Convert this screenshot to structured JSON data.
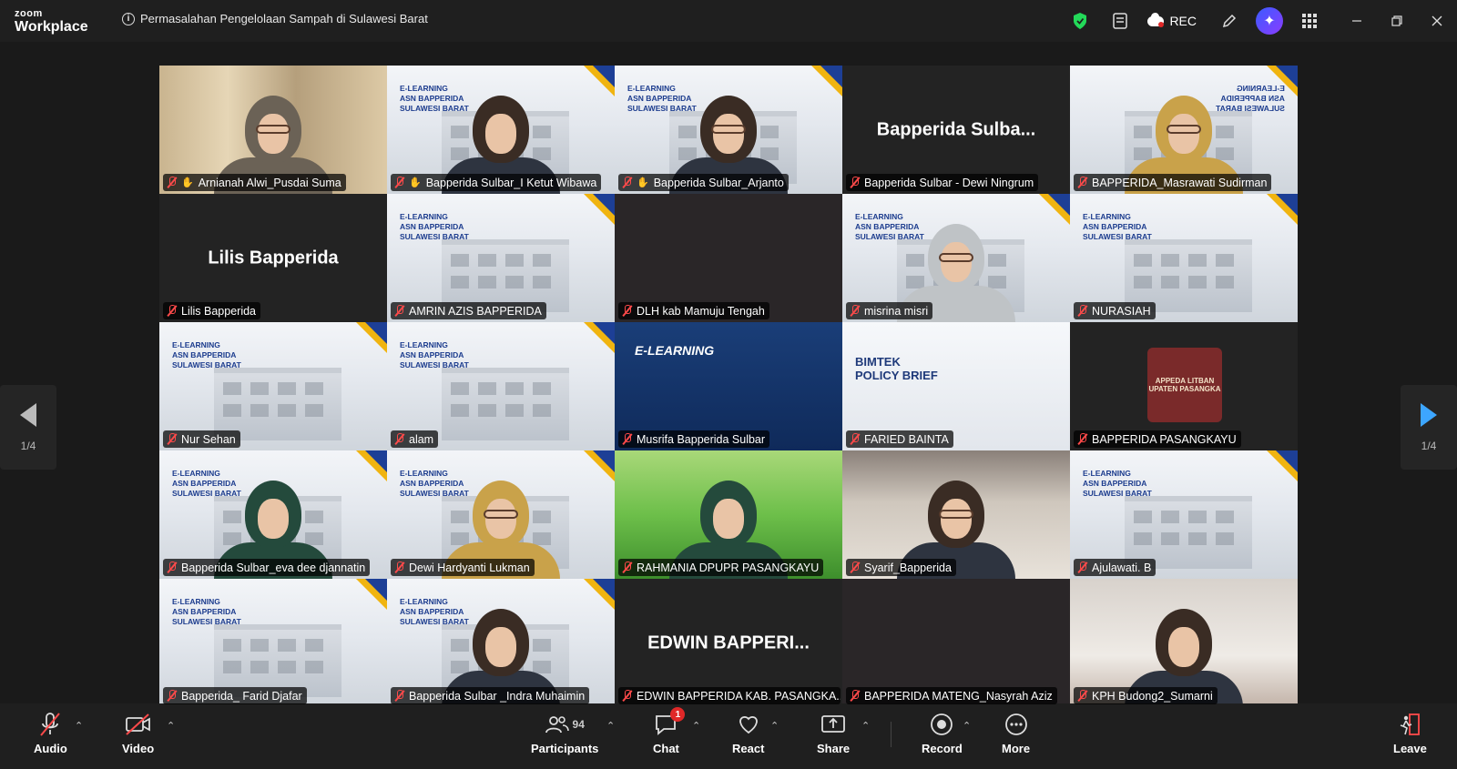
{
  "app": {
    "brand_top": "zoom",
    "brand_bottom": "Workplace"
  },
  "meeting": {
    "title": "Permasalahan Pengelolaan Sampah di Sulawesi Barat",
    "info_icon": "i"
  },
  "titlebar": {
    "rec_label": "REC"
  },
  "tiles": [
    {
      "name": "Arnianah Alwi_Pusdai Suma",
      "bg": "curtain",
      "hand": true,
      "active": true,
      "muted": true
    },
    {
      "name": "Bapperida Sulbar_I Ketut Wibawa",
      "bg": "elearn",
      "hand": true,
      "muted": true
    },
    {
      "name": "Bapperida Sulbar_Arjanto",
      "bg": "elearn",
      "hand": true,
      "muted": true
    },
    {
      "name": "Bapperida Sulbar - Dewi Ningrum",
      "bg": "dark",
      "big": "Bapperida  Sulba...",
      "muted": true
    },
    {
      "name": "BAPPERIDA_Masrawati Sudirman",
      "bg": "elearn",
      "mirror": true,
      "muted": true
    },
    {
      "name": "Lilis Bapperida",
      "bg": "dark",
      "big": "Lilis Bapperida",
      "muted": true
    },
    {
      "name": "AMRIN AZIS BAPPERIDA",
      "bg": "elearn",
      "muted": true
    },
    {
      "name": "DLH kab Mamuju Tengah",
      "bg": "darkest",
      "muted": true
    },
    {
      "name": "misrina misri",
      "bg": "elearn",
      "muted": true
    },
    {
      "name": "NURASIAH",
      "bg": "elearn",
      "muted": true
    },
    {
      "name": "Nur Sehan",
      "bg": "elearn",
      "muted": true
    },
    {
      "name": "alam",
      "bg": "elearn",
      "muted": true
    },
    {
      "name": "Musrifa Bapperida Sulbar",
      "bg": "blue",
      "muted": true
    },
    {
      "name": "FARIED BAINTA",
      "bg": "policy",
      "muted": true
    },
    {
      "name": "BAPPERIDA PASANGKAYU",
      "bg": "pasang",
      "muted": true
    },
    {
      "name": "Bapperida Sulbar_eva dee djannatin",
      "bg": "elearn",
      "muted": true
    },
    {
      "name": "Dewi Hardyanti Lukman",
      "bg": "elearn",
      "muted": true
    },
    {
      "name": "RAHMANIA DPUPR PASANGKAYU",
      "bg": "grass",
      "muted": true
    },
    {
      "name": "Syarif_Bapperida",
      "bg": "room",
      "muted": true
    },
    {
      "name": "Ajulawati. B",
      "bg": "elearn",
      "muted": true
    },
    {
      "name": "Bapperida_ Farid Djafar",
      "bg": "elearn",
      "muted": true
    },
    {
      "name": "Bapperida Sulbar _Indra Muhaimin",
      "bg": "elearn",
      "muted": true
    },
    {
      "name": "EDWIN BAPPERIDA KAB. PASANGKA...",
      "bg": "dark",
      "big": "EDWIN  BAPPERI...",
      "muted": true
    },
    {
      "name": "BAPPERIDA MATENG_Nasyrah Aziz",
      "bg": "darkest",
      "muted": true
    },
    {
      "name": "KPH Budong2_Sumarni",
      "bg": "room2",
      "muted": true
    }
  ],
  "slide_text": {
    "elearn": [
      "E-LEARNING",
      "ASN BAPPERIDA",
      "SULAWESI BARAT"
    ],
    "blue": "E-LEARNING",
    "policy": [
      "BIMTEK",
      "POLICY BRIEF"
    ],
    "pasang": "APPEDA LITBAN\nUPATEN PASANGKA"
  },
  "pager": {
    "left": "1/4",
    "right": "1/4"
  },
  "toolbar": {
    "audio": "Audio",
    "video": "Video",
    "participants": "Participants",
    "participants_count": "94",
    "chat": "Chat",
    "chat_badge": "1",
    "react": "React",
    "share": "Share",
    "record": "Record",
    "more": "More",
    "leave": "Leave"
  },
  "colors": {
    "active_speaker": "#23d959",
    "muted_mic": "#ff4a4a",
    "next_arrow": "#3da6ff",
    "badge": "#e02828"
  }
}
